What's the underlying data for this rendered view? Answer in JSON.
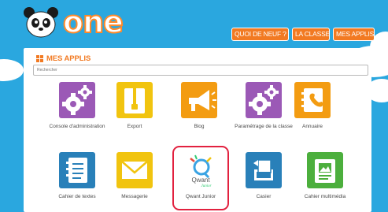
{
  "header": {
    "logo_text": "one",
    "nav": [
      "QUOI DE NEUF ?",
      "LA CLASSE",
      "MES APPLIS"
    ]
  },
  "panel": {
    "title": "MES APPLIS",
    "search_placeholder": "Rechercher"
  },
  "apps": [
    {
      "label": "Console d'administration",
      "icon": "gears-icon",
      "color": "#9b59b6"
    },
    {
      "label": "Export",
      "icon": "zip-file-icon",
      "color": "#f1c40f"
    },
    {
      "label": "Blog",
      "icon": "megaphone-icon",
      "color": "#f39c12"
    },
    {
      "label": "Paramétrage de la classe",
      "icon": "gears-icon",
      "color": "#9b59b6"
    },
    {
      "label": "Annuaire",
      "icon": "address-book-icon",
      "color": "#f39c12"
    },
    {
      "label": "Cahier de textes",
      "icon": "notebook-icon",
      "color": "#2980b9"
    },
    {
      "label": "Messagerie",
      "icon": "envelope-icon",
      "color": "#f1c40f"
    },
    {
      "label": "Qwant Junior",
      "icon": "qwant-junior-logo",
      "color": "#ffffff",
      "logo_text": "Qwant",
      "logo_sub": "Junior"
    },
    {
      "label": "Casier",
      "icon": "tray-icon",
      "color": "#2980b9"
    },
    {
      "label": "Cahier multimédia",
      "icon": "multimedia-book-icon",
      "color": "#4caf3d"
    }
  ]
}
